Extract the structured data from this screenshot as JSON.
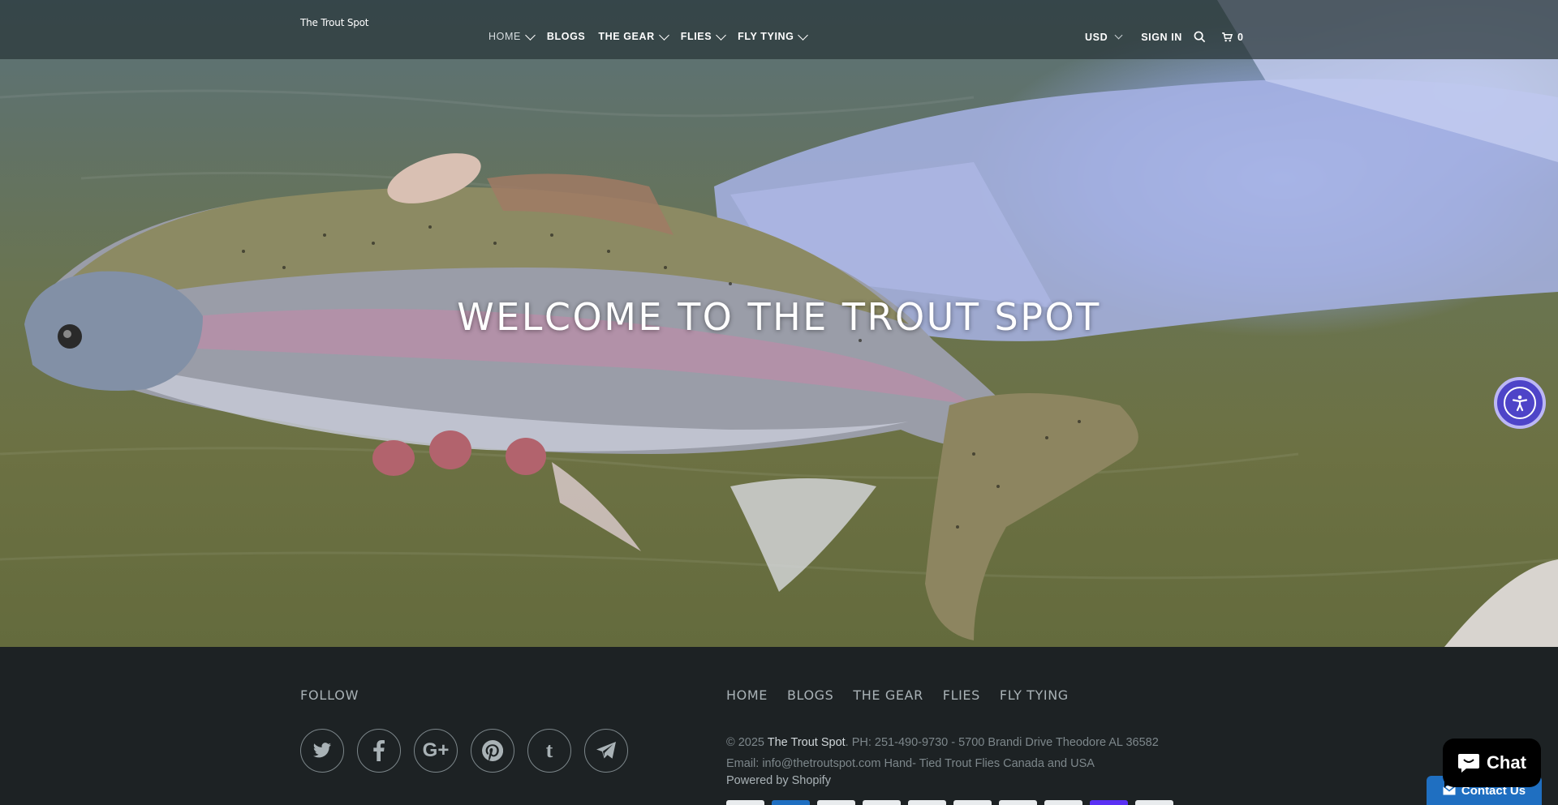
{
  "header": {
    "logo": "The Trout Spot",
    "nav": [
      {
        "label": "HOME",
        "has_dropdown": true,
        "active": true
      },
      {
        "label": "BLOGS",
        "has_dropdown": false
      },
      {
        "label": "THE GEAR",
        "has_dropdown": true
      },
      {
        "label": "FLIES",
        "has_dropdown": true
      },
      {
        "label": "FLY TYING",
        "has_dropdown": true
      }
    ],
    "currency": "USD",
    "sign_in": "SIGN IN",
    "cart_count": "0"
  },
  "hero": {
    "title": "WELCOME TO THE TROUT SPOT"
  },
  "footer": {
    "follow_heading": "FOLLOW",
    "social_icons": [
      "twitter-icon",
      "facebook-icon",
      "google-plus-icon",
      "pinterest-icon",
      "tumblr-icon",
      "telegram-icon"
    ],
    "nav": [
      "HOME",
      "BLOGS",
      "THE GEAR",
      "FLIES",
      "FLY TYING"
    ],
    "copyright_prefix": "© 2025 ",
    "brand": "The Trout Spot",
    "copyright_suffix": ". PH: 251-490-9730 - 5700 Brandi Drive Theodore AL 36582 Email: info@thetroutspot.com Hand- Tied Trout Flies Canada and USA",
    "powered_by": "Powered by Shopify",
    "payment_icons": [
      "payment-card-icon",
      "amex-icon",
      "payment-card-icon",
      "payment-card-icon",
      "payment-card-icon",
      "payment-card-icon",
      "payment-card-icon",
      "payment-card-icon",
      "shop-pay-icon",
      "payment-card-icon"
    ]
  },
  "widgets": {
    "chat_label": "Chat",
    "contact_label": "Contact Us",
    "accessibility_icon": "accessibility-icon"
  },
  "colors": {
    "footer_bg": "#1d2224",
    "accessibility": "#4e44c8",
    "contact": "#1f6fc1",
    "shop_pay": "#5a31f4"
  }
}
